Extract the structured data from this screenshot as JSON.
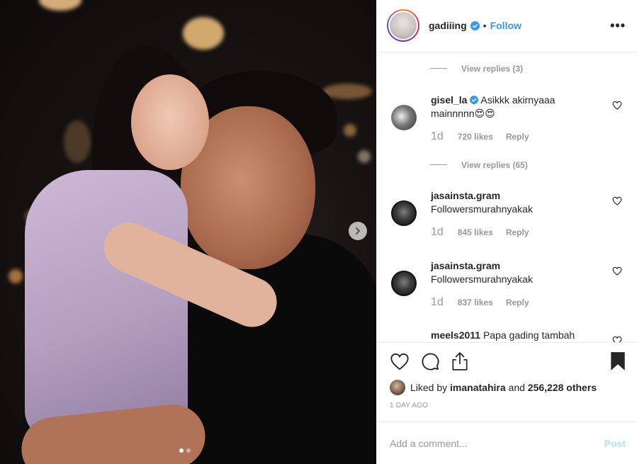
{
  "post": {
    "image_alt": "Man smiling while a young girl in a lilac dress hugs him",
    "carousel": {
      "count": 2,
      "active_index": 0
    }
  },
  "header": {
    "username": "gadiiing",
    "verified": true,
    "separator": "•",
    "follow_label": "Follow",
    "more_label": "•••"
  },
  "comments": {
    "view_replies_top": "View replies (3)",
    "items": [
      {
        "username": "gisel_la",
        "verified": true,
        "text": "Asikkk akirnyaaa mainnnnn😍😍",
        "time": "1d",
        "likes": "720 likes",
        "reply_label": "Reply",
        "view_replies": "View replies (65)"
      },
      {
        "username": "jasainsta.gram",
        "verified": false,
        "text": "Followersmurahnyakak",
        "time": "1d",
        "likes": "845 likes",
        "reply_label": "Reply"
      },
      {
        "username": "jasainsta.gram",
        "verified": false,
        "text": "Followersmurahnyakak",
        "time": "1d",
        "likes": "837 likes",
        "reply_label": "Reply"
      },
      {
        "username": "meels2011",
        "verified": false,
        "text": "Papa gading tambah"
      }
    ]
  },
  "likes_summary": {
    "prefix": "Liked by",
    "user": "imanatahira",
    "middle": "and",
    "others": "256,228 others"
  },
  "date_label": "1 DAY AGO",
  "add_comment": {
    "placeholder": "Add a comment...",
    "post_label": "Post"
  },
  "colors": {
    "link_blue": "#3897f0",
    "post_disabled": "#b2dffc",
    "muted_text": "#999999",
    "verified_badge": "#3897f0"
  }
}
